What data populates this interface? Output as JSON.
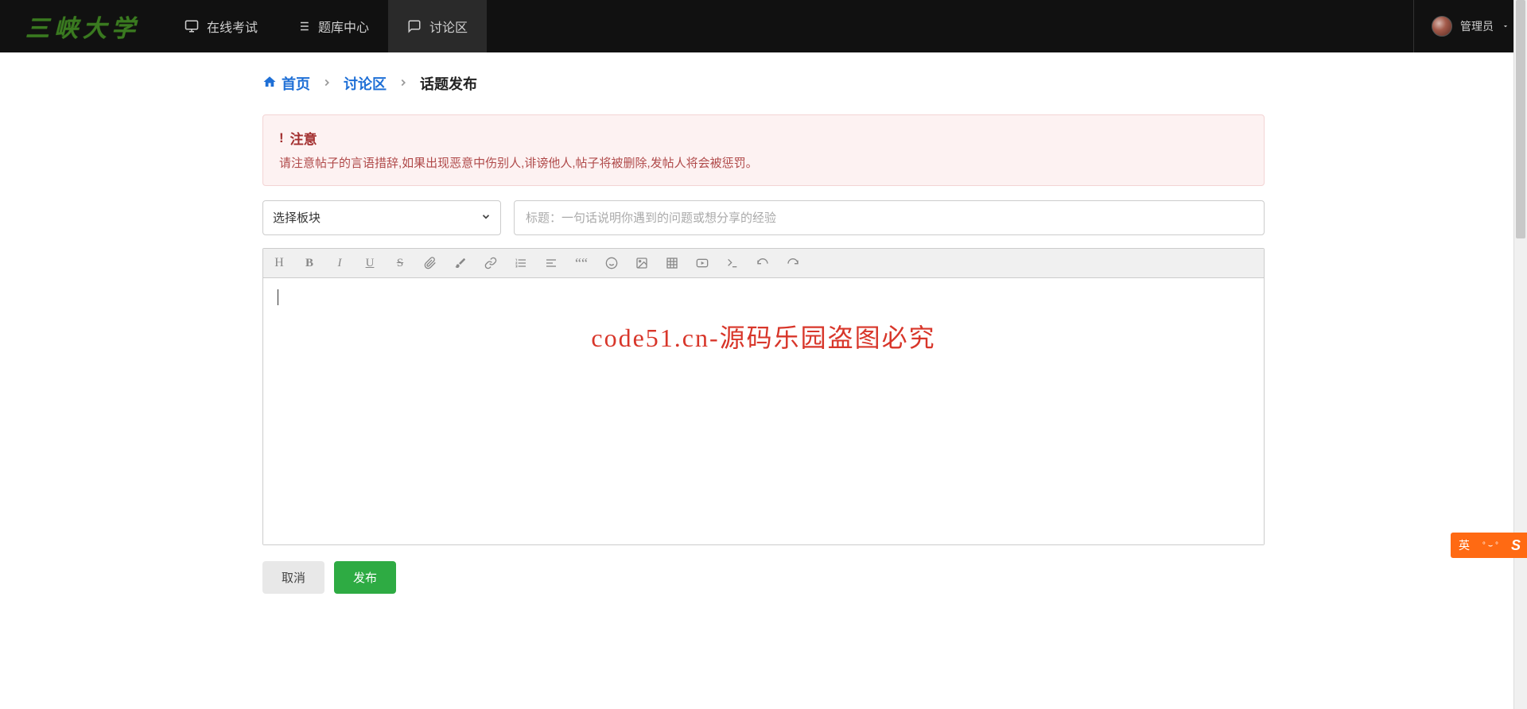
{
  "navbar": {
    "logo_text": "三峡大学",
    "items": [
      {
        "icon": "monitor",
        "label": "在线考试"
      },
      {
        "icon": "list",
        "label": "题库中心"
      },
      {
        "icon": "comment",
        "label": "讨论区"
      }
    ],
    "user": {
      "name": "管理员"
    }
  },
  "breadcrumb": {
    "home": "首页",
    "section": "讨论区",
    "current": "话题发布"
  },
  "alert": {
    "title": "注意",
    "body": "请注意帖子的言语措辞,如果出现恶意中伤别人,诽谤他人,帖子将被删除,发帖人将会被惩罚。"
  },
  "form": {
    "select_placeholder": "选择板块",
    "title_placeholder": "标题：一句话说明你遇到的问题或想分享的经验"
  },
  "editor": {
    "watermark": "code51.cn-源码乐园盗图必究",
    "toolbar": [
      "heading",
      "bold",
      "italic",
      "underline",
      "strikethrough",
      "attachment",
      "brush",
      "link",
      "ordered-list",
      "align",
      "quote",
      "emoji",
      "image",
      "table",
      "video",
      "terminal",
      "undo",
      "redo"
    ]
  },
  "actions": {
    "cancel": "取消",
    "publish": "发布"
  },
  "ime": {
    "lang": "英",
    "logo": "S"
  }
}
